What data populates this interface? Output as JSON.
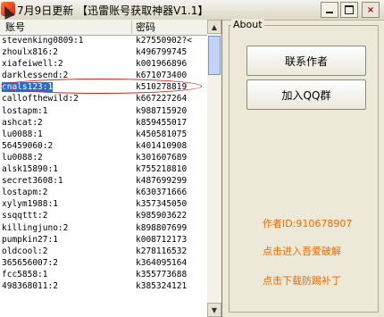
{
  "window": {
    "title": "7月9日更新 【迅雷账号获取神器V1.1】",
    "close_label": "×"
  },
  "list": {
    "headers": [
      "账号",
      "密码"
    ],
    "selected_index": 4,
    "rows": [
      {
        "user": "stevenking0809:1",
        "pass": "k27550902?<"
      },
      {
        "user": "zhoulx816:2",
        "pass": "k496799745"
      },
      {
        "user": "xiafeiwell:2",
        "pass": "k001966896"
      },
      {
        "user": "darklessend:2",
        "pass": "k671073400"
      },
      {
        "user": "cnals123:1",
        "pass": "k510278819"
      },
      {
        "user": "callofthewild:2",
        "pass": "k667227264"
      },
      {
        "user": "lostapm:1",
        "pass": "k988715920"
      },
      {
        "user": "ashcat:2",
        "pass": "k859455017"
      },
      {
        "user": "lu0088:1",
        "pass": "k450581075"
      },
      {
        "user": "56459060:2",
        "pass": "k401410908"
      },
      {
        "user": "lu0088:2",
        "pass": "k301607689"
      },
      {
        "user": "alsk15890:1",
        "pass": "k755218810"
      },
      {
        "user": "secret3608:1",
        "pass": "k487699299"
      },
      {
        "user": "lostapm:2",
        "pass": "k630371666"
      },
      {
        "user": "xylym1988:1",
        "pass": "k357345050"
      },
      {
        "user": "ssqqttt:2",
        "pass": "k985903622"
      },
      {
        "user": "killingjuno:2",
        "pass": "k898807699"
      },
      {
        "user": "pumpkin27:1",
        "pass": "k008712173"
      },
      {
        "user": "oldcool:2",
        "pass": "k278116532"
      },
      {
        "user": "365656007:2",
        "pass": "k364095164"
      },
      {
        "user": "fcc5858:1",
        "pass": "k355773688"
      },
      {
        "user": "498368011:2",
        "pass": "k385324121"
      }
    ]
  },
  "about": {
    "group_title": "About",
    "contact_button": "联系作者",
    "qq_group_button": "加入QQ群",
    "author_id": "作者ID:910678907",
    "forum_link": "点击进入吾爱破解",
    "patch_link": "点击下载防踢补丁"
  },
  "colors": {
    "accent_orange": "#f06a00",
    "selection_blue": "#316ac5",
    "annotation_red": "#e21f1f"
  }
}
